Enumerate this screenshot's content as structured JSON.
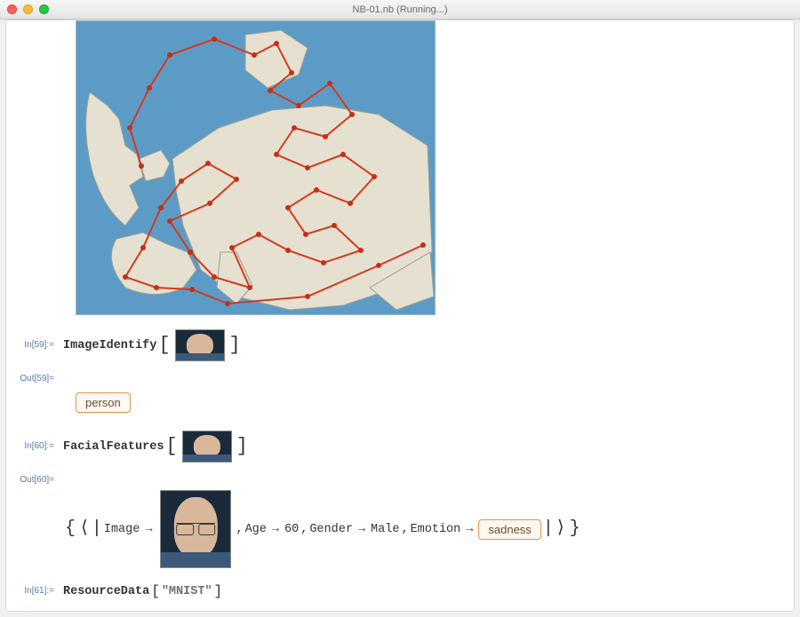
{
  "window": {
    "title": "NB-01.nb (Running...)"
  },
  "cells": {
    "in59": {
      "label": "In[59]:=",
      "fn": "ImageIdentify"
    },
    "out59": {
      "label": "Out[59]=",
      "value": "person"
    },
    "in60": {
      "label": "In[60]:=",
      "fn": "FacialFeatures"
    },
    "out60": {
      "label": "Out[60]=",
      "keys": {
        "image": "Image",
        "age": "Age",
        "gender": "Gender",
        "emotion": "Emotion"
      },
      "values": {
        "age": "60",
        "gender": "Male",
        "emotion": "sadness"
      },
      "arrow": "→",
      "comma": ", "
    },
    "in61": {
      "label": "In[61]:=",
      "fn": "ResourceData",
      "arg": "\"MNIST\""
    }
  },
  "glyphs": {
    "lbracket": "[",
    "rbracket": "]",
    "lbrace": "{",
    "rbrace": "}",
    "langle": "⟨",
    "rangle": "⟩",
    "pipe": "|"
  }
}
